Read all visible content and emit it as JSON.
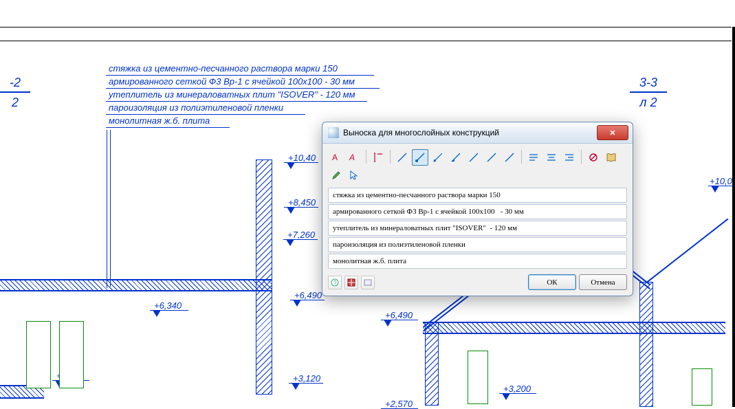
{
  "section_left": {
    "top": "-2",
    "bottom": "2"
  },
  "section_right": {
    "top": "3-3",
    "bottom": "л 2"
  },
  "notes": [
    "стяжка из цементно-песчанного раствора марки 150",
    "армированного сеткой Ф3 Вр-1 с ячейкой 100х100   - 30 мм",
    "утеплитель из минераловатных плит \"ISOVER\"  - 120 мм",
    "пароизоляция из полиэтиленовой пленки",
    "монолитная ж.б. плита"
  ],
  "elevations_left": [
    "+10,40",
    "+8,450",
    "+7,260",
    "+6,490",
    "+6,340",
    "+3,200",
    "+3,120"
  ],
  "elevations_right": [
    "+10,0",
    "+6,490",
    "+3,200",
    "+2,570"
  ],
  "dialog": {
    "title": "Выноска для многослойных конструкций",
    "rows": [
      "стяжка из цементно-песчанного раствора марки 150",
      "армированного сеткой Ф3 Вр-1 с ячейкой 100х100   - 30 мм",
      "утеплитель из минераловатных плит \"ISOVER\"  - 120 мм",
      "пароизоляция из полиэтиленовой пленки",
      "монолитная ж.б. плита"
    ],
    "ok": "ОК",
    "cancel": "Отмена"
  }
}
